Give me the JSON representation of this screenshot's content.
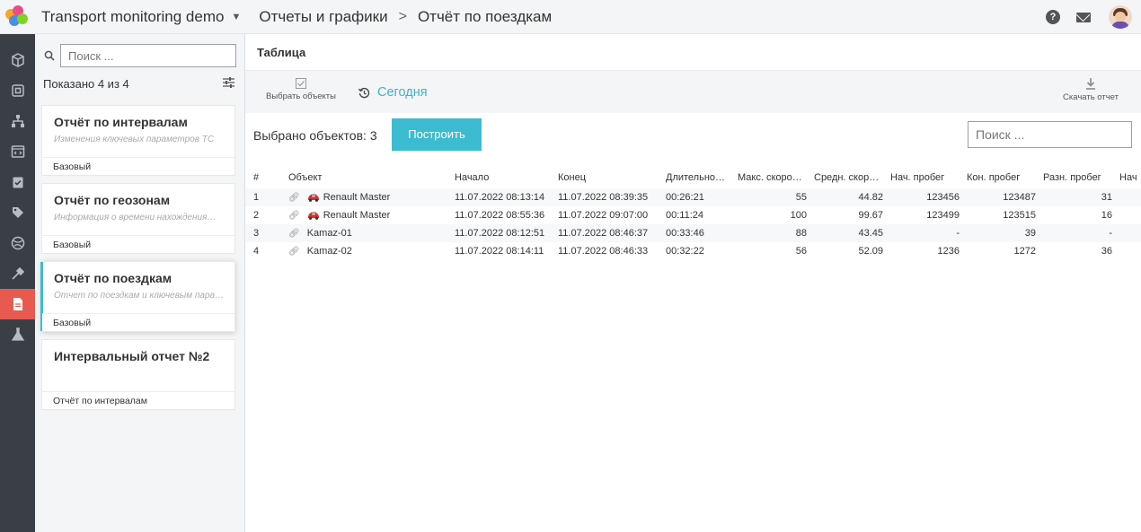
{
  "header": {
    "app_title": "Transport monitoring demo",
    "breadcrumb_section": "Отчеты и графики",
    "breadcrumb_page": "Отчёт по поездкам"
  },
  "sidebar": {
    "search_placeholder": "Поиск ...",
    "shown_count": "Показано 4 из 4",
    "reports": [
      {
        "title": "Отчёт по интервалам",
        "description": "Изменения ключевых параметров ТС",
        "type": "Базовый"
      },
      {
        "title": "Отчёт по геозонам",
        "description": "Информация о времени нахождения…",
        "type": "Базовый"
      },
      {
        "title": "Отчёт по поездкам",
        "description": "Отчет по поездкам и ключевым пара…",
        "type": "Базовый"
      },
      {
        "title": "Интервальный отчет №2",
        "description": "",
        "type": "Отчёт по интервалам"
      }
    ]
  },
  "main": {
    "tab": "Таблица",
    "select_objects_label": "Выбрать объекты",
    "period_label": "Сегодня",
    "download_label": "Скачать отчет",
    "selected_text": "Выбрано объектов: 3",
    "build_button": "Построить",
    "search_placeholder": "Поиск ..."
  },
  "table": {
    "columns": [
      "#",
      "Объект",
      "Начало",
      "Конец",
      "Длительно…",
      "Макс. скоро…",
      "Средн. скор…",
      "Нач. пробег",
      "Кон. пробег",
      "Разн. пробег",
      "Нач"
    ],
    "rows": [
      {
        "n": "1",
        "object": "Renault Master",
        "car": true,
        "start": "11.07.2022 08:13:14",
        "end": "11.07.2022 08:39:35",
        "duration": "00:26:21",
        "max_speed": "55",
        "avg_speed": "44.82",
        "start_mileage": "123456",
        "end_mileage": "123487",
        "diff_mileage": "31"
      },
      {
        "n": "2",
        "object": "Renault Master",
        "car": true,
        "start": "11.07.2022 08:55:36",
        "end": "11.07.2022 09:07:00",
        "duration": "00:11:24",
        "max_speed": "100",
        "avg_speed": "99.67",
        "start_mileage": "123499",
        "end_mileage": "123515",
        "diff_mileage": "16"
      },
      {
        "n": "3",
        "object": "Kamaz-01",
        "car": false,
        "start": "11.07.2022 08:12:51",
        "end": "11.07.2022 08:46:37",
        "duration": "00:33:46",
        "max_speed": "88",
        "avg_speed": "43.45",
        "start_mileage": "-",
        "end_mileage": "39",
        "diff_mileage": "-"
      },
      {
        "n": "4",
        "object": "Kamaz-02",
        "car": false,
        "start": "11.07.2022 08:14:11",
        "end": "11.07.2022 08:46:33",
        "duration": "00:32:22",
        "max_speed": "56",
        "avg_speed": "52.09",
        "start_mileage": "1236",
        "end_mileage": "1272",
        "diff_mileage": "36"
      }
    ]
  },
  "colors": {
    "accent": "#3bbcd0",
    "rail_bg": "#3a3f46",
    "rail_active": "#e85a4f"
  }
}
